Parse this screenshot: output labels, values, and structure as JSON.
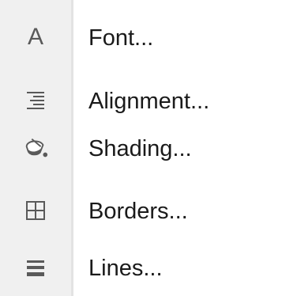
{
  "menu": {
    "items": [
      {
        "id": "font",
        "label": "Font...",
        "icon": "font-icon",
        "icon_glyph": "A"
      },
      {
        "id": "alignment",
        "label": "Alignment...",
        "icon": "alignment-icon"
      },
      {
        "id": "shading",
        "label": "Shading...",
        "icon": "paint-bucket-icon"
      },
      {
        "id": "borders",
        "label": "Borders...",
        "icon": "borders-grid-icon"
      },
      {
        "id": "lines",
        "label": "Lines...",
        "icon": "lines-icon"
      }
    ]
  },
  "colors": {
    "gutter": "#f0f0f0",
    "icon": "#5a5a5a",
    "text": "#1a1a1a"
  }
}
